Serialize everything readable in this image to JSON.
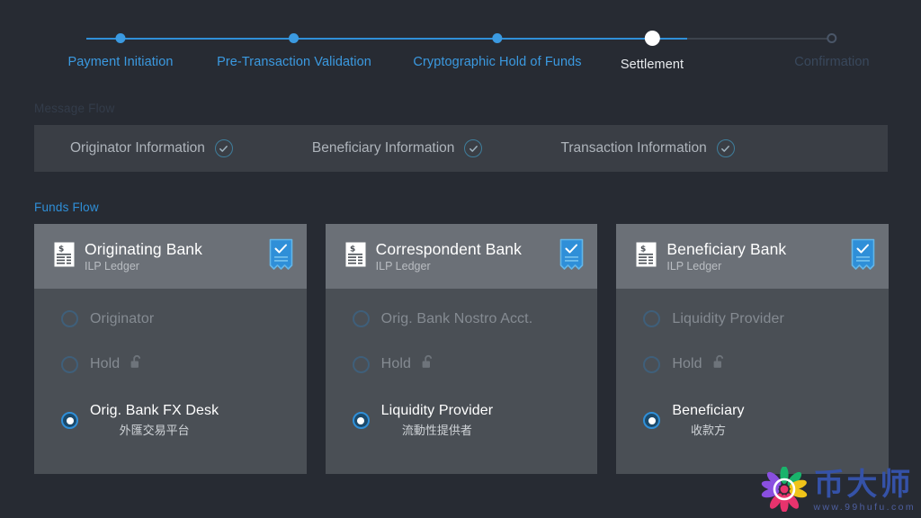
{
  "stepper": {
    "steps": [
      {
        "label": "Payment Initiation",
        "state": "done"
      },
      {
        "label": "Pre-Transaction Validation",
        "state": "done"
      },
      {
        "label": "Cryptographic Hold of Funds",
        "state": "done"
      },
      {
        "label": "Settlement",
        "state": "current"
      },
      {
        "label": "Confirmation",
        "state": "pending"
      }
    ],
    "colors": {
      "done": "#3b9ae1",
      "current": "#ffffff",
      "pending": "#39485c",
      "track": "#3d434d"
    }
  },
  "message_flow": {
    "section_label": "Message Flow",
    "items": [
      {
        "label": "Originator Information",
        "icon": "check-circle-icon",
        "checked": true
      },
      {
        "label": "Beneficiary Information",
        "icon": "check-circle-icon",
        "checked": true
      },
      {
        "label": "Transaction Information",
        "icon": "check-circle-icon",
        "checked": true
      }
    ]
  },
  "funds_flow": {
    "section_label": "Funds Flow",
    "cards": [
      {
        "bank": "Originating Bank",
        "ledger": "ILP Ledger",
        "doc_icon": "invoice-dollar-icon",
        "badge_icon": "certified-receipt-icon",
        "rows": [
          {
            "label": "Originator",
            "sub": "",
            "selected": false,
            "lock": false
          },
          {
            "label": "Hold",
            "sub": "",
            "selected": false,
            "lock": true,
            "lock_icon": "unlocked-padlock-icon"
          },
          {
            "label": "Orig. Bank FX Desk",
            "sub": "外匯交易平台",
            "selected": true,
            "lock": false
          }
        ]
      },
      {
        "bank": "Correspondent Bank",
        "ledger": "ILP Ledger",
        "doc_icon": "invoice-dollar-icon",
        "badge_icon": "certified-receipt-icon",
        "rows": [
          {
            "label": "Orig. Bank Nostro Acct.",
            "sub": "",
            "selected": false,
            "lock": false
          },
          {
            "label": "Hold",
            "sub": "",
            "selected": false,
            "lock": true,
            "lock_icon": "unlocked-padlock-icon"
          },
          {
            "label": "Liquidity Provider",
            "sub": "流動性提供者",
            "selected": true,
            "lock": false
          }
        ]
      },
      {
        "bank": "Beneficiary Bank",
        "ledger": "ILP Ledger",
        "doc_icon": "invoice-dollar-icon",
        "badge_icon": "certified-receipt-icon",
        "rows": [
          {
            "label": "Liquidity Provider",
            "sub": "",
            "selected": false,
            "lock": false
          },
          {
            "label": "Hold",
            "sub": "",
            "selected": false,
            "lock": true,
            "lock_icon": "unlocked-padlock-icon"
          },
          {
            "label": "Beneficiary",
            "sub": "收款方",
            "selected": true,
            "lock": false
          }
        ]
      }
    ]
  },
  "watermark": {
    "brand": "币大师",
    "url": "www.99hufu.com",
    "logo_icon": "flower-logo-icon",
    "brand_color": "#3552a8"
  }
}
